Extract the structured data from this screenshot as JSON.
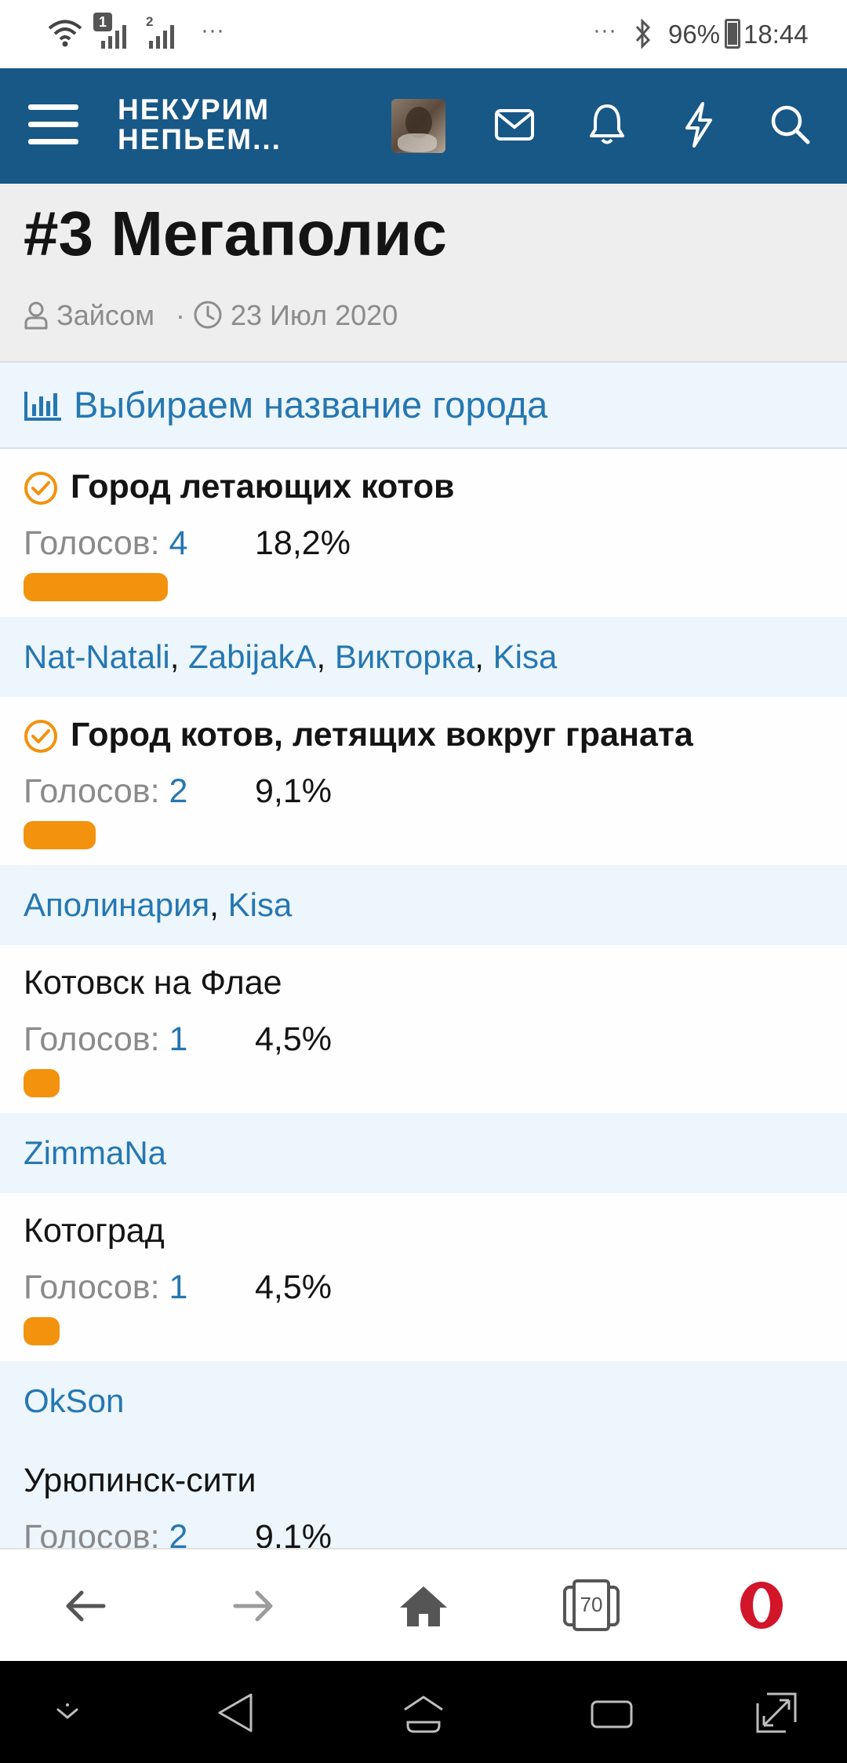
{
  "status_bar": {
    "wifi_icon": "wifi-icon",
    "sim1_badge": "1",
    "sim2_badge": "2",
    "dots_left": "···",
    "dots_right": "···",
    "battery": "96%",
    "time": "18:44"
  },
  "app_bar": {
    "brand_line1": "НЕКУРИМ",
    "brand_line2": "НЕПЬЕМ...",
    "icons": [
      "menu-icon",
      "avatar",
      "mail-icon",
      "bell-icon",
      "lightning-icon",
      "search-icon"
    ]
  },
  "thread": {
    "title": "#3 Мегаполис",
    "author": "Зайсом",
    "separator": "·",
    "date": "23 Июл 2020"
  },
  "poll": {
    "title": "Выбираем название города",
    "votes_label": "Голосов:",
    "options": [
      {
        "label": "Город летающих котов",
        "checked": true,
        "votes": "4",
        "percent": "18,2%",
        "fraction": 0.182,
        "voters": [
          "Nat-Natali",
          "ZabijakA",
          "Викторка",
          "Kisa"
        ]
      },
      {
        "label": "Город котов, летящих вокруг граната",
        "checked": true,
        "votes": "2",
        "percent": "9,1%",
        "fraction": 0.091,
        "voters": [
          "Аполинария",
          "Kisa"
        ]
      },
      {
        "label": "Котовск на Флае",
        "checked": false,
        "votes": "1",
        "percent": "4,5%",
        "fraction": 0.045,
        "voters": [
          "ZimmaNa"
        ]
      },
      {
        "label": "Котоград",
        "checked": false,
        "votes": "1",
        "percent": "4,5%",
        "fraction": 0.045,
        "voters": [
          "OkSon"
        ]
      },
      {
        "label": "Урюпинск-сити",
        "checked": false,
        "votes": "2",
        "percent": "9,1%",
        "fraction": 0.091,
        "voters": []
      }
    ]
  },
  "browser_bar": {
    "tabs_count": "70",
    "icons": [
      "back-icon",
      "forward-icon",
      "home-icon",
      "tabs-icon",
      "opera-icon"
    ]
  },
  "colors": {
    "header": "#185886",
    "accent_link": "#2577b1",
    "bar": "#f3920d",
    "opera_red": "#d3152a"
  }
}
